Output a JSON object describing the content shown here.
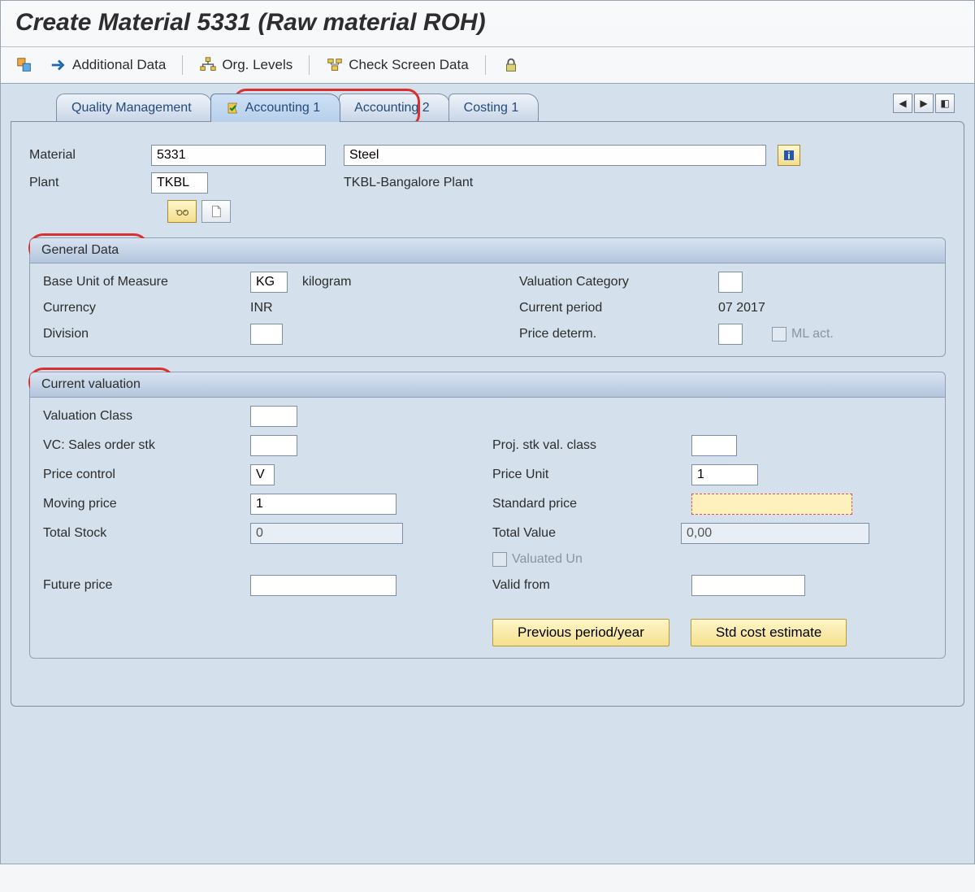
{
  "title": "Create Material 5331 (Raw material ROH)",
  "toolbar": {
    "additionalData": "Additional Data",
    "orgLevels": "Org. Levels",
    "checkScreenData": "Check Screen Data"
  },
  "tabs": {
    "qualityMgmt": "Quality Management",
    "accounting1": "Accounting 1",
    "accounting2": "Accounting 2",
    "costing1": "Costing 1"
  },
  "header": {
    "materialLabel": "Material",
    "materialNo": "5331",
    "materialDesc": "Steel",
    "plantLabel": "Plant",
    "plantCode": "TKBL",
    "plantDesc": "TKBL-Bangalore Plant"
  },
  "generalData": {
    "title": "General Data",
    "baseUoMLabel": "Base Unit of Measure",
    "baseUoM": "KG",
    "baseUoMText": "kilogram",
    "valuationCatLabel": "Valuation Category",
    "valuationCat": "",
    "currencyLabel": "Currency",
    "currency": "INR",
    "currentPeriodLabel": "Current period",
    "currentPeriod": "07 2017",
    "divisionLabel": "Division",
    "division": "",
    "priceDetermLabel": "Price determ.",
    "priceDeterm": "",
    "mlActLabel": "ML act."
  },
  "currentValuation": {
    "title": "Current valuation",
    "valuationClassLabel": "Valuation Class",
    "valuationClass": "",
    "vcSalesOrderStkLabel": "VC: Sales order stk",
    "vcSalesOrderStk": "",
    "projStkValClassLabel": "Proj. stk val. class",
    "projStkValClass": "",
    "priceControlLabel": "Price control",
    "priceControl": "V",
    "priceUnitLabel": "Price Unit",
    "priceUnit": "1",
    "movingPriceLabel": "Moving price",
    "movingPrice": "1",
    "standardPriceLabel": "Standard price",
    "standardPrice": "",
    "totalStockLabel": "Total Stock",
    "totalStock": "0",
    "totalValueLabel": "Total Value",
    "totalValue": "0,00",
    "valuatedUnLabel": "Valuated Un",
    "futurePriceLabel": "Future price",
    "futurePrice": "",
    "validFromLabel": "Valid from",
    "validFrom": "",
    "btnPrevPeriod": "Previous period/year",
    "btnStdCost": "Std cost estimate"
  }
}
